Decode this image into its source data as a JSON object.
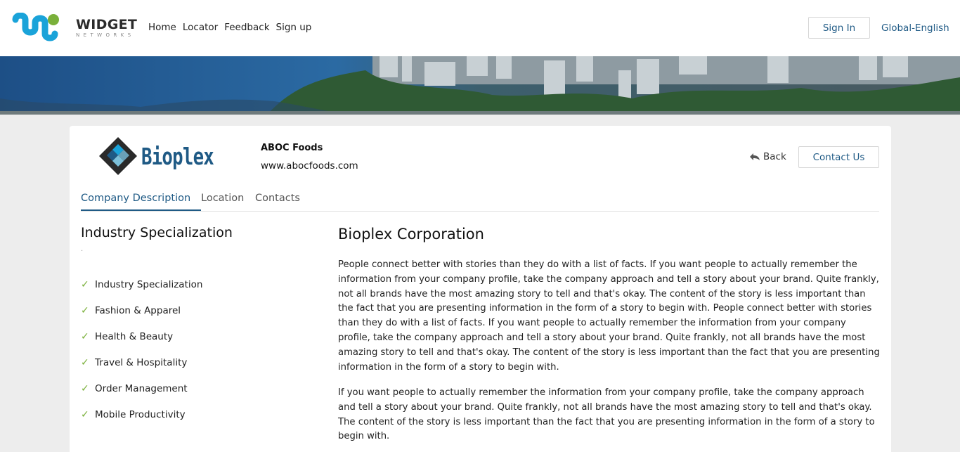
{
  "header": {
    "logo_text": "WIDGET",
    "logo_subtext": "NETWORKS",
    "nav": [
      "Home",
      "Locator",
      "Feedback",
      "Sign up"
    ],
    "sign_in": "Sign In",
    "language": "Global-English"
  },
  "company": {
    "logo_text": "Bioplex",
    "name": "ABOC Foods",
    "url": "www.abocfoods.com",
    "back": "Back",
    "contact": "Contact Us"
  },
  "tabs": [
    "Company Description",
    "Location",
    "Contacts"
  ],
  "sidebar": {
    "title": "Industry Specialization",
    "dot": ".",
    "items": [
      "Industry Specialization",
      "Fashion & Apparel",
      "Health & Beauty",
      "Travel & Hospitality",
      "Order Management",
      "Mobile Productivity"
    ]
  },
  "main": {
    "title": "Bioplex Corporation",
    "paragraphs": [
      "People connect better with stories than they do with a list of facts. If you want people to actually remember the information from your company profile, take the company approach and tell a story about your brand. Quite frankly, not all brands have the most amazing story to tell and that's okay. The content of the story is less important than the fact that you are presenting information in the form of a story to begin with. People connect better with stories than they do with a list of facts. If you want people to actually remember the information from your company profile, take the company approach and tell a story about your brand. Quite frankly, not all brands have the most amazing story to tell and that's okay. The content of the story is less important than the fact that you are presenting information in the form of a story to begin with.",
      "If you want people to actually remember the information from your company profile, take the company approach and tell a story about your brand. Quite frankly, not all brands have the most amazing story to tell and that's okay. The content of the story is less important than the fact that you are presenting information in the form of a story to begin with."
    ]
  },
  "colors": {
    "brand_blue": "#1f5a85",
    "logo_cyan": "#1aa3d9",
    "logo_green": "#7ab03a",
    "check_green": "#7ab03a"
  }
}
